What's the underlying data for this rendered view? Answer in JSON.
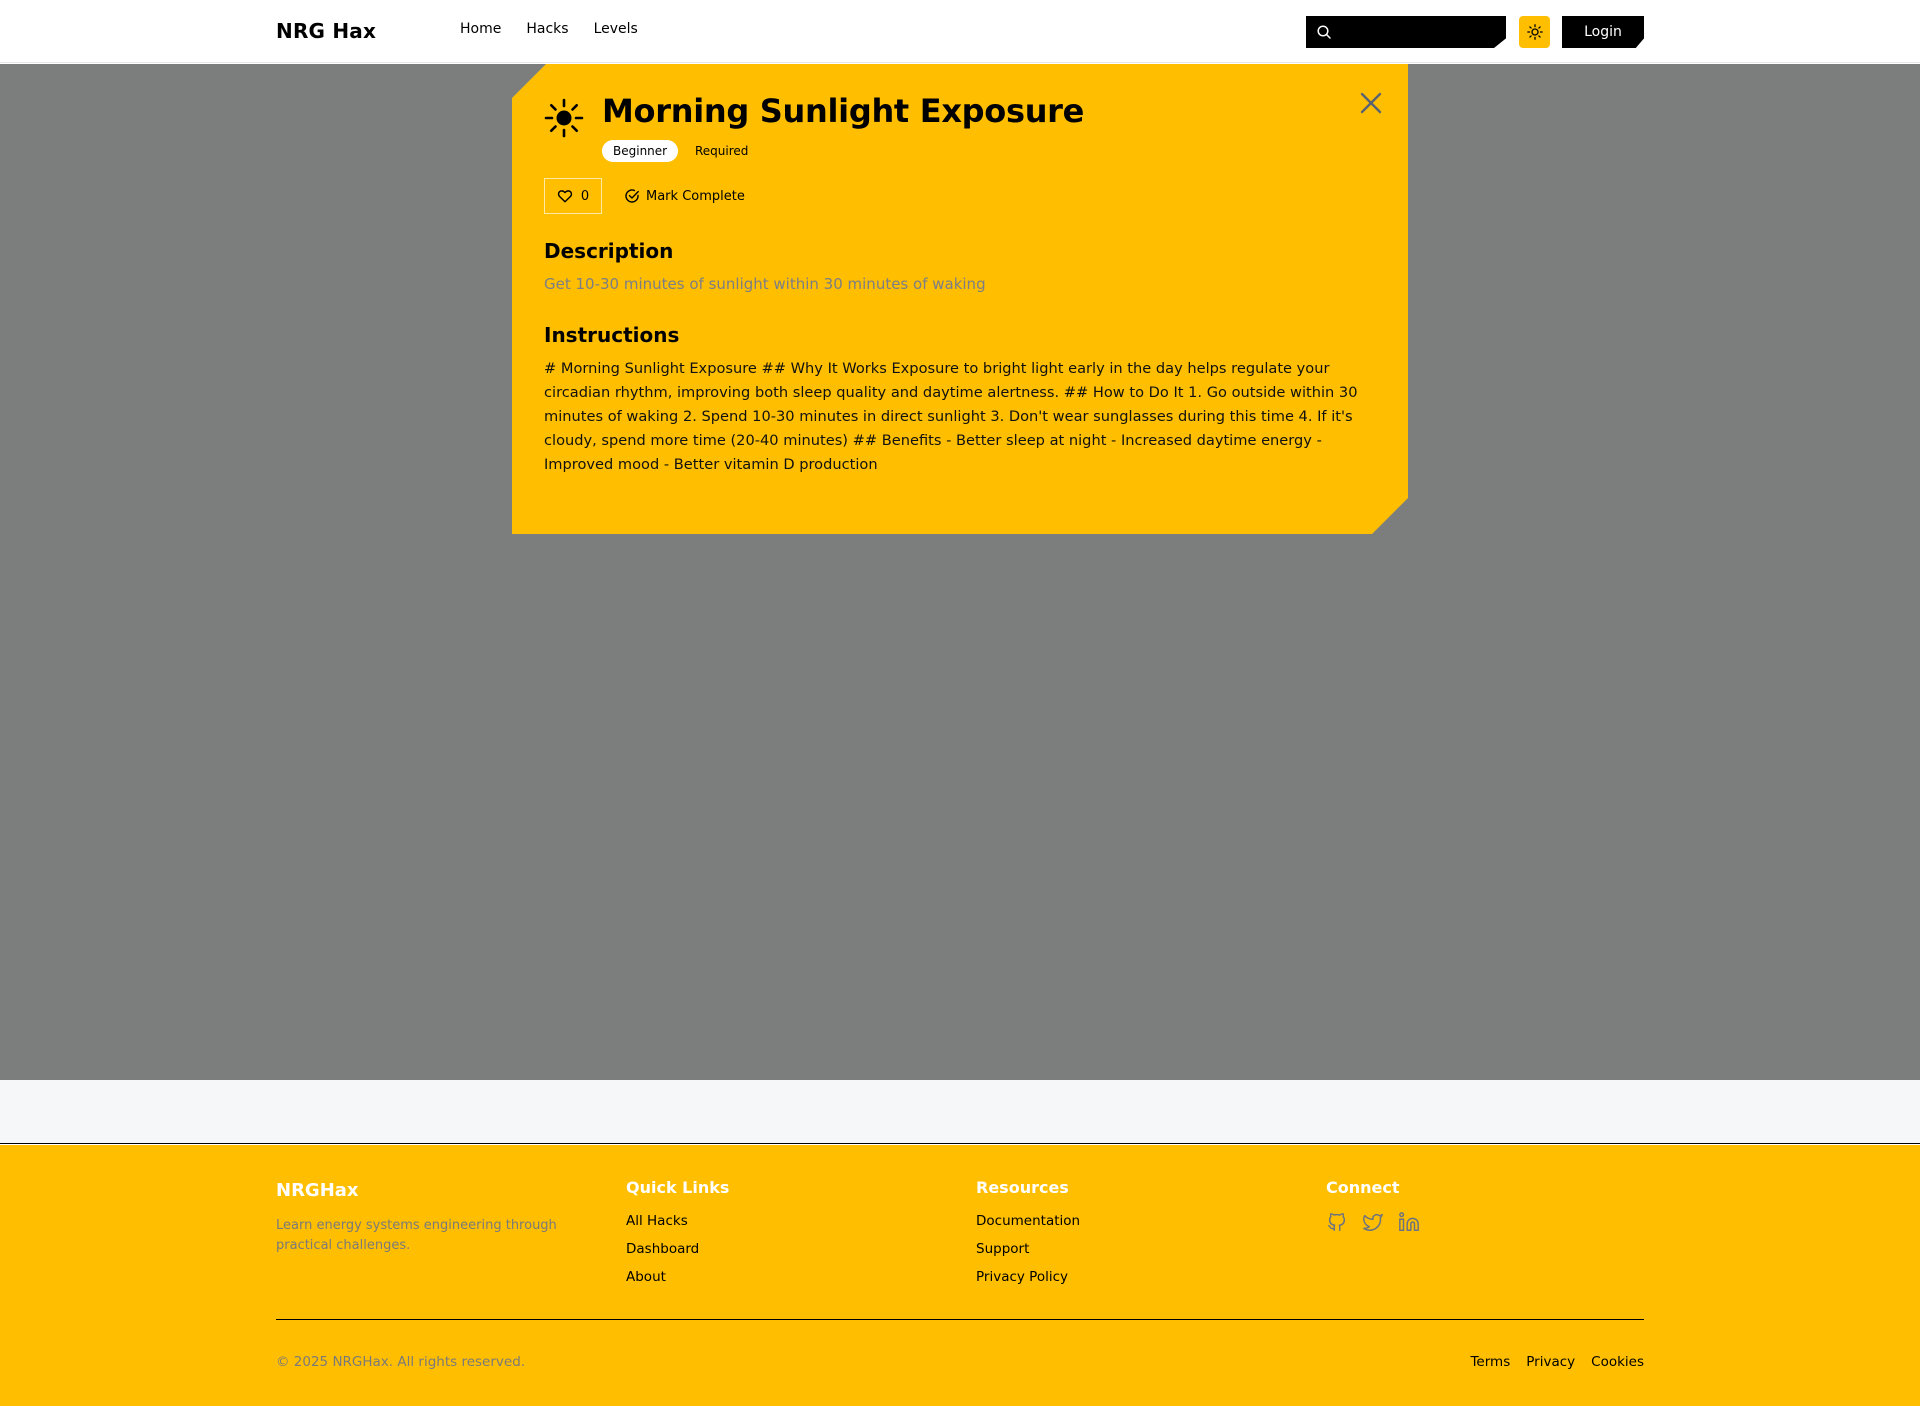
{
  "header": {
    "brand": "NRG Hax",
    "nav": [
      "Home",
      "Hacks",
      "Levels"
    ],
    "search_placeholder": "",
    "theme_icon": "sun-icon",
    "login_label": "Login"
  },
  "modal": {
    "icon": "sun-icon",
    "title": "Morning Sunlight Exposure",
    "badges": [
      "Beginner",
      "Required"
    ],
    "like_count": "0",
    "complete_label": "Mark Complete",
    "description_heading": "Description",
    "description": "Get 10-30 minutes of sunlight within 30 minutes of waking",
    "instructions_heading": "Instructions",
    "instructions": "# Morning Sunlight Exposure ## Why It Works Exposure to bright light early in the day helps regulate your circadian rhythm, improving both sleep quality and daytime alertness. ## How to Do It 1. Go outside within 30 minutes of waking 2. Spend 10-30 minutes in direct sunlight 3. Don't wear sunglasses during this time 4. If it's cloudy, spend more time (20-40 minutes) ## Benefits - Better sleep at night - Increased daytime energy - Improved mood - Better vitamin D production"
  },
  "footer": {
    "brand": "NRGHax",
    "tagline": "Learn energy systems engineering through practical challenges.",
    "quick_links": {
      "heading": "Quick Links",
      "items": [
        "All Hacks",
        "Dashboard",
        "About"
      ]
    },
    "resources": {
      "heading": "Resources",
      "items": [
        "Documentation",
        "Support",
        "Privacy Policy"
      ]
    },
    "connect": {
      "heading": "Connect",
      "icons": [
        "github-icon",
        "twitter-icon",
        "linkedin-icon"
      ]
    },
    "copyright": "© 2025 NRGHax. All rights reserved.",
    "legal": [
      "Terms",
      "Privacy",
      "Cookies"
    ]
  },
  "colors": {
    "accent": "#ffbe00",
    "overlay": "#7c7e7d",
    "muted_text": "#7b7e86"
  }
}
